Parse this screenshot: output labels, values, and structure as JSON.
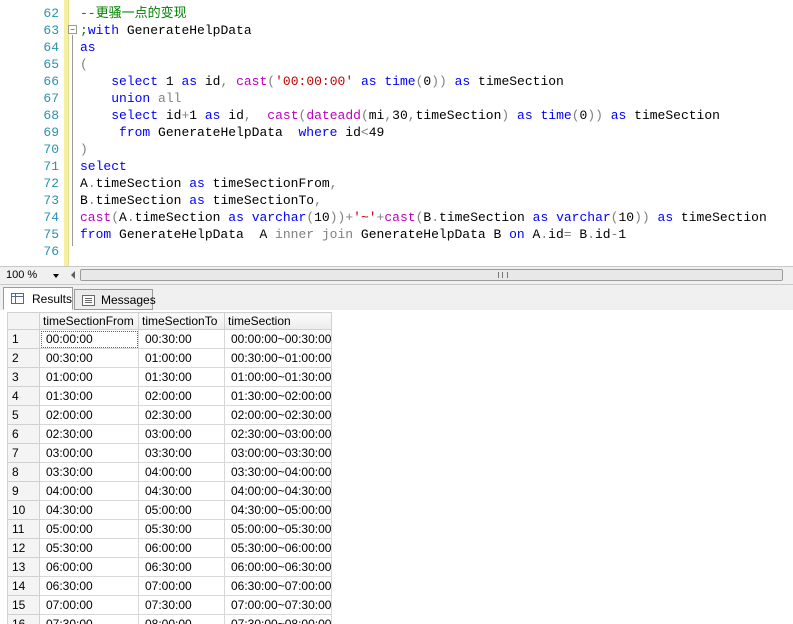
{
  "editor": {
    "lines": [
      {
        "num": "62",
        "tokens": [
          [
            "cm",
            "--更骚一点的变现"
          ]
        ]
      },
      {
        "num": "63",
        "tokens": [
          [
            "cm",
            ";"
          ],
          [
            "kw",
            "with"
          ],
          [
            "",
            " GenerateHelpData"
          ]
        ]
      },
      {
        "num": "64",
        "tokens": [
          [
            "kw",
            "as"
          ]
        ]
      },
      {
        "num": "65",
        "tokens": [
          [
            "gr",
            "("
          ]
        ]
      },
      {
        "num": "66",
        "tokens": [
          [
            "",
            "    "
          ],
          [
            "kw",
            "select"
          ],
          [
            "",
            " 1 "
          ],
          [
            "kw",
            "as"
          ],
          [
            "",
            " id"
          ],
          [
            "gr",
            ","
          ],
          [
            "",
            " "
          ],
          [
            "fn",
            "cast"
          ],
          [
            "gr",
            "("
          ],
          [
            "str",
            "'00:00:00'"
          ],
          [
            "",
            " "
          ],
          [
            "kw",
            "as"
          ],
          [
            "",
            " "
          ],
          [
            "kw",
            "time"
          ],
          [
            "gr",
            "("
          ],
          [
            "",
            "0"
          ],
          [
            "gr",
            "))"
          ],
          [
            "",
            " "
          ],
          [
            "kw",
            "as"
          ],
          [
            "",
            " timeSection"
          ]
        ]
      },
      {
        "num": "67",
        "tokens": [
          [
            "",
            "    "
          ],
          [
            "kw",
            "union"
          ],
          [
            "",
            " "
          ],
          [
            "gr",
            "all"
          ]
        ]
      },
      {
        "num": "68",
        "tokens": [
          [
            "",
            "    "
          ],
          [
            "kw",
            "select"
          ],
          [
            "",
            " id"
          ],
          [
            "gr",
            "+"
          ],
          [
            "",
            "1 "
          ],
          [
            "kw",
            "as"
          ],
          [
            "",
            " id"
          ],
          [
            "gr",
            ","
          ],
          [
            "",
            "  "
          ],
          [
            "fn",
            "cast"
          ],
          [
            "gr",
            "("
          ],
          [
            "fn",
            "dateadd"
          ],
          [
            "gr",
            "("
          ],
          [
            "",
            "mi"
          ],
          [
            "gr",
            ","
          ],
          [
            "",
            "30"
          ],
          [
            "gr",
            ","
          ],
          [
            "",
            "timeSection"
          ],
          [
            "gr",
            ")"
          ],
          [
            "",
            " "
          ],
          [
            "kw",
            "as"
          ],
          [
            "",
            " "
          ],
          [
            "kw",
            "time"
          ],
          [
            "gr",
            "("
          ],
          [
            "",
            "0"
          ],
          [
            "gr",
            "))"
          ],
          [
            "",
            " "
          ],
          [
            "kw",
            "as"
          ],
          [
            "",
            " timeSection"
          ]
        ]
      },
      {
        "num": "69",
        "tokens": [
          [
            "",
            "     "
          ],
          [
            "kw",
            "from"
          ],
          [
            "",
            " GenerateHelpData  "
          ],
          [
            "kw",
            "where"
          ],
          [
            "",
            " id"
          ],
          [
            "gr",
            "<"
          ],
          [
            "",
            "49"
          ]
        ]
      },
      {
        "num": "70",
        "tokens": [
          [
            "gr",
            ")"
          ]
        ]
      },
      {
        "num": "71",
        "tokens": [
          [
            "kw",
            "select"
          ]
        ]
      },
      {
        "num": "72",
        "tokens": [
          [
            "",
            "A"
          ],
          [
            "gr",
            "."
          ],
          [
            "",
            "timeSection "
          ],
          [
            "kw",
            "as"
          ],
          [
            "",
            " timeSectionFrom"
          ],
          [
            "gr",
            ","
          ]
        ]
      },
      {
        "num": "73",
        "tokens": [
          [
            "",
            "B"
          ],
          [
            "gr",
            "."
          ],
          [
            "",
            "timeSection "
          ],
          [
            "kw",
            "as"
          ],
          [
            "",
            " timeSectionTo"
          ],
          [
            "gr",
            ","
          ]
        ]
      },
      {
        "num": "74",
        "tokens": [
          [
            "fn",
            "cast"
          ],
          [
            "gr",
            "("
          ],
          [
            "",
            "A"
          ],
          [
            "gr",
            "."
          ],
          [
            "",
            "timeSection "
          ],
          [
            "kw",
            "as"
          ],
          [
            "",
            " "
          ],
          [
            "kw",
            "varchar"
          ],
          [
            "gr",
            "("
          ],
          [
            "",
            "10"
          ],
          [
            "gr",
            "))+"
          ],
          [
            "str",
            "'~'"
          ],
          [
            "gr",
            "+"
          ],
          [
            "fn",
            "cast"
          ],
          [
            "gr",
            "("
          ],
          [
            "",
            "B"
          ],
          [
            "gr",
            "."
          ],
          [
            "",
            "timeSection "
          ],
          [
            "kw",
            "as"
          ],
          [
            "",
            " "
          ],
          [
            "kw",
            "varchar"
          ],
          [
            "gr",
            "("
          ],
          [
            "",
            "10"
          ],
          [
            "gr",
            "))"
          ],
          [
            "",
            " "
          ],
          [
            "kw",
            "as"
          ],
          [
            "",
            " timeSection"
          ]
        ]
      },
      {
        "num": "75",
        "tokens": [
          [
            "kw",
            "from"
          ],
          [
            "",
            " GenerateHelpData  A "
          ],
          [
            "gr",
            "inner"
          ],
          [
            "",
            " "
          ],
          [
            "gr",
            "join"
          ],
          [
            "",
            " GenerateHelpData B "
          ],
          [
            "kw",
            "on"
          ],
          [
            "",
            " A"
          ],
          [
            "gr",
            "."
          ],
          [
            "",
            "id"
          ],
          [
            "gr",
            "="
          ],
          [
            "",
            " B"
          ],
          [
            "gr",
            "."
          ],
          [
            "",
            "id"
          ],
          [
            "gr",
            "-"
          ],
          [
            "",
            "1"
          ]
        ]
      },
      {
        "num": "76",
        "tokens": []
      }
    ]
  },
  "zoom": {
    "value": "100 %"
  },
  "tabs": {
    "results": "Results",
    "messages": "Messages"
  },
  "grid": {
    "columns": [
      "timeSectionFrom",
      "timeSectionTo",
      "timeSection"
    ],
    "rows": [
      [
        "1",
        "00:00:00",
        "00:30:00",
        "00:00:00~00:30:00"
      ],
      [
        "2",
        "00:30:00",
        "01:00:00",
        "00:30:00~01:00:00"
      ],
      [
        "3",
        "01:00:00",
        "01:30:00",
        "01:00:00~01:30:00"
      ],
      [
        "4",
        "01:30:00",
        "02:00:00",
        "01:30:00~02:00:00"
      ],
      [
        "5",
        "02:00:00",
        "02:30:00",
        "02:00:00~02:30:00"
      ],
      [
        "6",
        "02:30:00",
        "03:00:00",
        "02:30:00~03:00:00"
      ],
      [
        "7",
        "03:00:00",
        "03:30:00",
        "03:00:00~03:30:00"
      ],
      [
        "8",
        "03:30:00",
        "04:00:00",
        "03:30:00~04:00:00"
      ],
      [
        "9",
        "04:00:00",
        "04:30:00",
        "04:00:00~04:30:00"
      ],
      [
        "10",
        "04:30:00",
        "05:00:00",
        "04:30:00~05:00:00"
      ],
      [
        "11",
        "05:00:00",
        "05:30:00",
        "05:00:00~05:30:00"
      ],
      [
        "12",
        "05:30:00",
        "06:00:00",
        "05:30:00~06:00:00"
      ],
      [
        "13",
        "06:00:00",
        "06:30:00",
        "06:00:00~06:30:00"
      ],
      [
        "14",
        "06:30:00",
        "07:00:00",
        "06:30:00~07:00:00"
      ],
      [
        "15",
        "07:00:00",
        "07:30:00",
        "07:00:00~07:30:00"
      ],
      [
        "16",
        "07:30:00",
        "08:00:00",
        "07:30:00~08:00:00"
      ]
    ]
  }
}
